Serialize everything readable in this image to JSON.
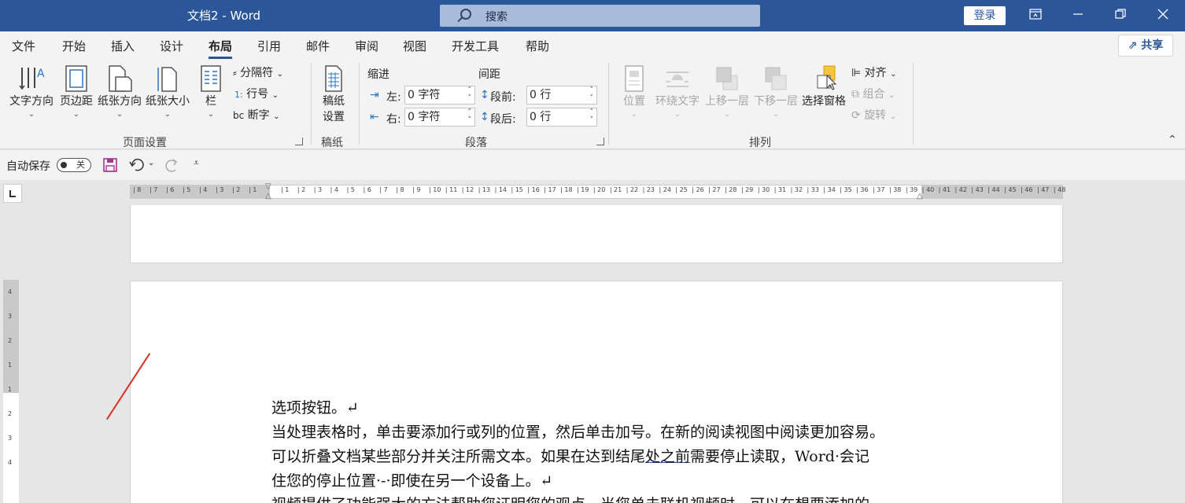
{
  "window": {
    "title": "文档2  -  Word",
    "search_placeholder": "搜索",
    "login_label": "登录"
  },
  "menu": {
    "tabs": [
      "文件",
      "开始",
      "插入",
      "设计",
      "布局",
      "引用",
      "邮件",
      "审阅",
      "视图",
      "开发工具",
      "帮助"
    ],
    "active_tab": "布局",
    "share_label": "共享"
  },
  "ribbon": {
    "page_setup": {
      "group_label": "页面设置",
      "text_direction": "文字方向",
      "margins": "页边距",
      "orientation": "纸张方向",
      "size": "纸张大小",
      "columns": "栏",
      "breaks": "分隔符",
      "line_numbers": "行号",
      "hyphenation": "断字"
    },
    "manuscript": {
      "group_label": "稿纸",
      "button_line1": "稿纸",
      "button_line2": "设置"
    },
    "paragraph": {
      "group_label": "段落",
      "indent_title": "缩进",
      "spacing_title": "间距",
      "left_label": "左:",
      "right_label": "右:",
      "before_label": "段前:",
      "after_label": "段后:",
      "left_value": "0 字符",
      "right_value": "0 字符",
      "before_value": "0 行",
      "after_value": "0 行"
    },
    "arrange": {
      "group_label": "排列",
      "position": "位置",
      "wrap_text": "环绕文字",
      "bring_forward": "上移一层",
      "send_backward": "下移一层",
      "selection_pane": "选择窗格",
      "align": "对齐",
      "group": "组合",
      "rotate": "旋转"
    }
  },
  "qat": {
    "autosave_label": "自动保存",
    "autosave_state": "关"
  },
  "ruler": {
    "horizontal_left": [
      "8",
      "7",
      "6",
      "5",
      "4",
      "3",
      "2",
      "1"
    ],
    "horizontal_right": [
      "1",
      "2",
      "3",
      "4",
      "5",
      "6",
      "7",
      "8",
      "9",
      "10",
      "11",
      "12",
      "13",
      "14",
      "15",
      "16",
      "17",
      "18",
      "19",
      "20",
      "21",
      "22",
      "23",
      "24",
      "25",
      "26",
      "27",
      "28",
      "29",
      "30",
      "31",
      "32",
      "33",
      "34",
      "35",
      "36",
      "37",
      "38",
      "39",
      "40",
      "41",
      "42",
      "43",
      "44",
      "45",
      "46",
      "47",
      "48"
    ],
    "vertical": [
      "4",
      "3",
      "2",
      "1",
      "1",
      "2",
      "3",
      "4"
    ]
  },
  "document": {
    "lines": {
      "l1": "选项按钮。↵",
      "l2": "当处理表格时，单击要添加行或列的位置，然后单击加号。在新的阅读视图中阅读更加容易。",
      "l3a": "可以折叠文档某些部分并关注所需文本。如果在达到结尾",
      "l3u": "处之前",
      "l3b": "需要停止读取，Word·会记",
      "l4": "住您的停止位置·-·即使在另一个设备上。↵",
      "l5": "视频提供了功能强大的方法帮助您证明您的观点。当您单击联机视频时，可以在想要添加的"
    }
  }
}
